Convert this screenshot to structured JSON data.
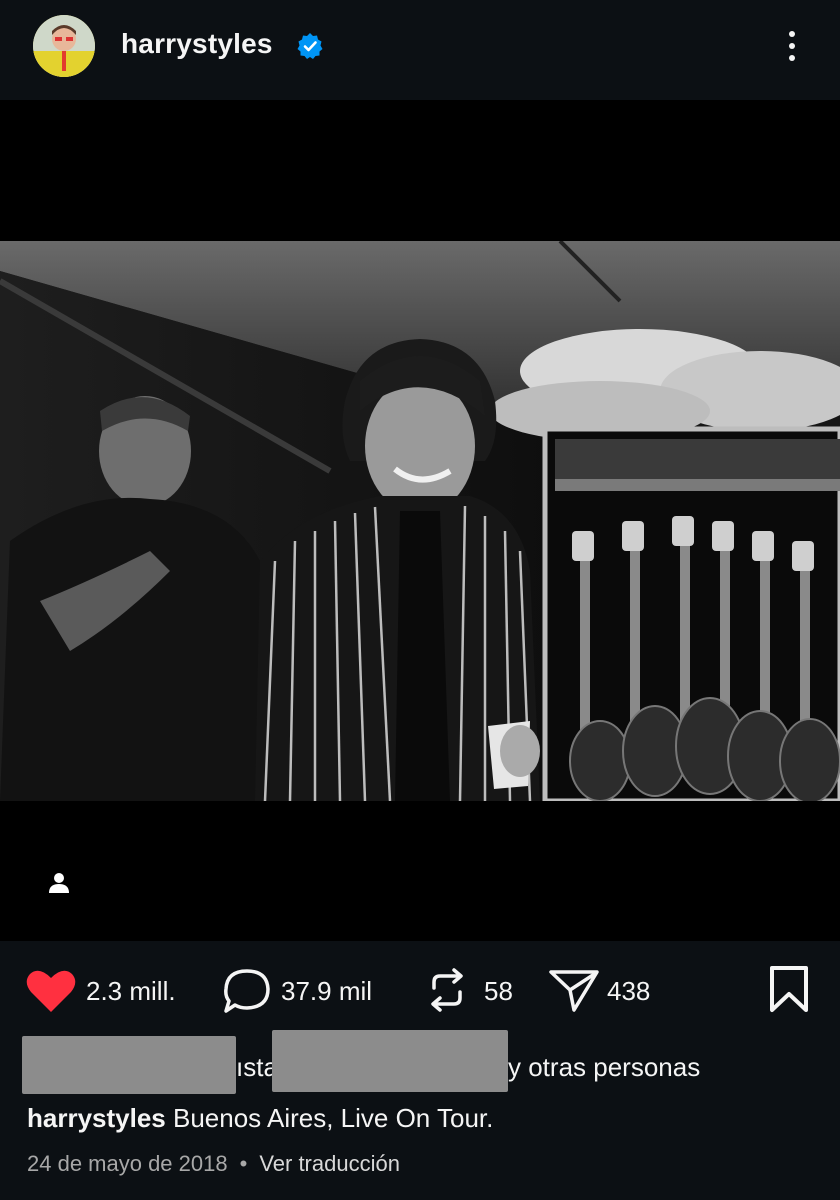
{
  "header": {
    "username": "harrystyles",
    "verified_icon": "verified-badge-icon",
    "more_icon": "more-vertical-icon"
  },
  "post": {
    "photo_description_icon": "photo",
    "tag_icon": "user-tag-icon"
  },
  "actions": {
    "likes": "2.3 mill.",
    "comments": "37.9 mil",
    "reposts": "58",
    "shares": "438",
    "like_color": "#ff3040"
  },
  "liked_by": {
    "partial_1": "ısta",
    "suffix": "y otras personas"
  },
  "caption": {
    "author": "harrystyles",
    "text": "Buenos Aires, Live On Tour."
  },
  "meta": {
    "date": "24 de mayo de 2018",
    "separator": "•",
    "translate": "Ver traducción"
  }
}
